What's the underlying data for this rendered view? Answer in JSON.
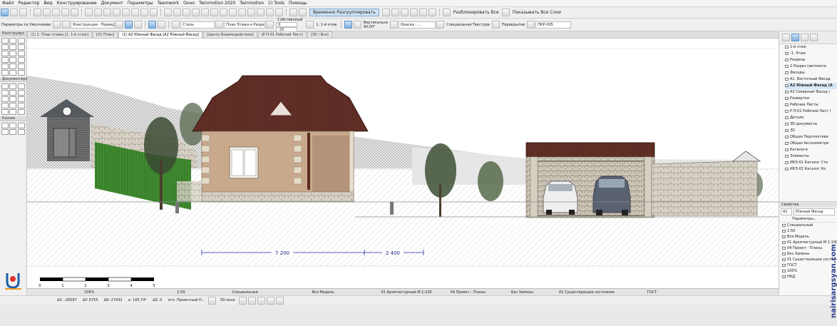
{
  "menu": [
    "Файл",
    "Редактор",
    "Вид",
    "Конструирование",
    "Документ",
    "Параметры",
    "Teamwork",
    "Окно",
    "Twinmotion 2020",
    "Twinmotion",
    "CI Tools",
    "Помощь"
  ],
  "toolbar1": {
    "ungroup_label": "Временно Разгруппировать",
    "unlock_all_label": "Разблокировать Все",
    "show_all_layers_label": "Показывать Все Слои"
  },
  "toolbar2": {
    "default_params_label": "Параметры по Умолчанию",
    "construction_select": "Конструкция - Перекрыты",
    "steel_select": "Сталь",
    "floor_plan_select": "План Этажа и Разрез...",
    "own_label": "Собственный",
    "elevation_value": "0",
    "height_value": "-25",
    "story_label": "1. 1-й этаж",
    "vertical_label": "Вертикально",
    "vertical_value": "90,00°",
    "paint_label": "Краска - ...",
    "special_texture_label": "Специальная Текстура",
    "overlap_label": "Перекрытие",
    "id_value": "ПКР-005"
  },
  "left_panel": {
    "sections": [
      "Конструиро",
      "Документиро",
      "Разное"
    ]
  },
  "tabs": [
    {
      "label": "(1) 1. План этажа [1. 1-й этаж]",
      "active": false
    },
    {
      "label": "[01 План]",
      "active": false
    },
    {
      "label": "(1) A2 Южный Фасад [A2 Южный Фасад]",
      "active": true
    },
    {
      "label": "[Центр Взаимодействия]",
      "active": false
    },
    {
      "label": "[Р.П-01 Рабочий Лист]",
      "active": false
    },
    {
      "label": "[3D / Все]",
      "active": false
    }
  ],
  "drawing": {
    "dim_left": "7 200",
    "dim_right": "2 400",
    "scale_ticks": [
      "0",
      "1",
      "2",
      "3",
      "4",
      "5"
    ]
  },
  "navigator": {
    "items": [
      {
        "label": "1-й этаж",
        "sel": false
      },
      {
        "label": "-1. Этаж",
        "sel": false
      },
      {
        "label": "Разрезы",
        "sel": false
      },
      {
        "label": "2 Разрез (автомати",
        "sel": false
      },
      {
        "label": "Фасады",
        "sel": false
      },
      {
        "label": "A1. Восточный Фасад",
        "sel": false
      },
      {
        "label": "A2 Южный Фасад (А",
        "sel": true
      },
      {
        "label": "A3 Северный Фасад (",
        "sel": false
      },
      {
        "label": "Развертки",
        "sel": false
      },
      {
        "label": "Рабочие Листы",
        "sel": false
      },
      {
        "label": "Р.П-01 Рабочий Лист (",
        "sel": false
      },
      {
        "label": "Детали",
        "sel": false
      },
      {
        "label": "3D-документы",
        "sel": false
      },
      {
        "label": "3D",
        "sel": false
      },
      {
        "label": "Общая Перспектива",
        "sel": false
      },
      {
        "label": "Общая Аксонометри",
        "sel": false
      },
      {
        "label": "Каталоги",
        "sel": false
      },
      {
        "label": "Элементы",
        "sel": false
      },
      {
        "label": "ИКЭ-01 Каталог Сте",
        "sel": false
      },
      {
        "label": "ИКЭ-02 Каталог Ко",
        "sel": false
      }
    ],
    "properties_label": "Свойства",
    "prop_id": "A2",
    "prop_name": "Южный Фасад",
    "params_label": "Параметры...",
    "settings": [
      "Специальный",
      "1:50",
      "Вся Модель",
      "01 Архитектурный М 1:100",
      "04 Проект - Планы",
      "Без Замены",
      "01 Существующее состояние",
      "ГОСТ",
      "100%",
      "НКД"
    ]
  },
  "bottombar": {
    "zoom": "109%",
    "scale": "1:50",
    "special": "Специальный",
    "model": "Вся Модель",
    "arch": "01 Архитектурный М 1:100",
    "project": "04 Проект - Планы",
    "no_replace": "Без Замены",
    "state": "01 Существующее состояние",
    "standard": "ГОСТ"
  },
  "coords": {
    "dx": "ΔX: -26587",
    "dy": "ΔY: 6755",
    "dr": "ΔR: 27432",
    "angle": "α: 165,74°",
    "dz": "ΔZ: 0",
    "ref": "отн. Проектный Н...",
    "view3d": "3D-окно"
  },
  "watermark": "nairisargsyan.com",
  "colors": {
    "roof": "#5a2a22",
    "wall": "#c9a98c",
    "accent": "#1e5fa8"
  }
}
